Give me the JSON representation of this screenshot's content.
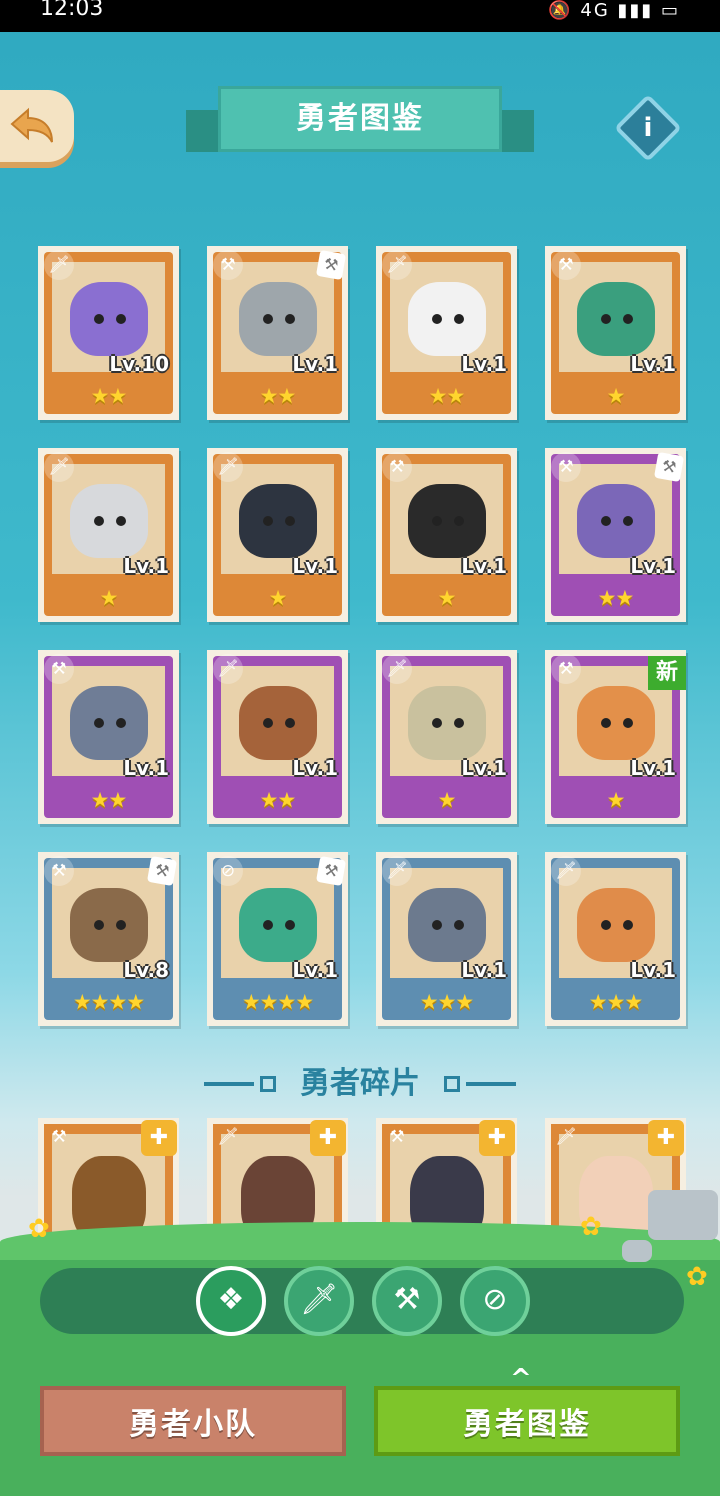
{
  "status_bar": {
    "time": "12:03",
    "icons": "🔕 4G ▮▮▮ ▭"
  },
  "header": {
    "title": "勇者图鉴",
    "info_label": "i"
  },
  "cards": [
    {
      "level": "Lv.10",
      "stars": 2,
      "frame": "orange",
      "role": "sword",
      "weapon": "",
      "new": false,
      "head_color": "#8a6fd1"
    },
    {
      "level": "Lv.1",
      "stars": 2,
      "frame": "orange",
      "role": "hammer",
      "weapon": "hammer",
      "new": false,
      "head_color": "#9ea6ab"
    },
    {
      "level": "Lv.1",
      "stars": 2,
      "frame": "orange",
      "role": "sword",
      "weapon": "",
      "new": false,
      "head_color": "#f2f2f2"
    },
    {
      "level": "Lv.1",
      "stars": 1,
      "frame": "orange",
      "role": "hammer",
      "weapon": "",
      "new": false,
      "head_color": "#3a9f7e"
    },
    {
      "level": "Lv.1",
      "stars": 1,
      "frame": "orange",
      "role": "sword",
      "weapon": "",
      "new": false,
      "head_color": "#d7d9dc"
    },
    {
      "level": "Lv.1",
      "stars": 1,
      "frame": "orange",
      "role": "sword",
      "weapon": "",
      "new": false,
      "head_color": "#2d3440"
    },
    {
      "level": "Lv.1",
      "stars": 1,
      "frame": "orange",
      "role": "hammer",
      "weapon": "",
      "new": false,
      "head_color": "#2a2a2a"
    },
    {
      "level": "Lv.1",
      "stars": 2,
      "frame": "purple",
      "role": "hammer",
      "weapon": "hammer",
      "new": false,
      "head_color": "#7b67b8"
    },
    {
      "level": "Lv.1",
      "stars": 2,
      "frame": "purple",
      "role": "hammer",
      "weapon": "",
      "new": false,
      "head_color": "#6f7d96"
    },
    {
      "level": "Lv.1",
      "stars": 2,
      "frame": "purple",
      "role": "sword",
      "weapon": "",
      "new": false,
      "head_color": "#a5633a"
    },
    {
      "level": "Lv.1",
      "stars": 1,
      "frame": "purple",
      "role": "sword",
      "weapon": "",
      "new": false,
      "head_color": "#c9c19e"
    },
    {
      "level": "Lv.1",
      "stars": 1,
      "frame": "purple",
      "role": "hammer",
      "weapon": "",
      "new": true,
      "new_label": "新",
      "head_color": "#e3904a"
    },
    {
      "level": "Lv.8",
      "stars": 4,
      "frame": "blue",
      "role": "hammer",
      "weapon": "hammer",
      "new": false,
      "head_color": "#8a6a4a"
    },
    {
      "level": "Lv.1",
      "stars": 4,
      "frame": "blue",
      "role": "compass",
      "weapon": "hammer",
      "new": false,
      "head_color": "#3cab8a"
    },
    {
      "level": "Lv.1",
      "stars": 3,
      "frame": "blue",
      "role": "sword",
      "weapon": "",
      "new": false,
      "head_color": "#6c7a8e"
    },
    {
      "level": "Lv.1",
      "stars": 3,
      "frame": "blue",
      "role": "sword",
      "weapon": "",
      "new": false,
      "head_color": "#e08c4a"
    }
  ],
  "fragments_section": {
    "title": "勇者碎片"
  },
  "fragments": [
    {
      "role": "hammer",
      "head_color": "#8a5a2a"
    },
    {
      "role": "sword",
      "head_color": "#6a4436"
    },
    {
      "role": "hammer",
      "head_color": "#3a3a4a"
    },
    {
      "role": "sword",
      "head_color": "#f2d0b8"
    }
  ],
  "filters": [
    {
      "name": "all",
      "icon": "❖",
      "active": true
    },
    {
      "name": "sword",
      "icon": "🗡",
      "active": false
    },
    {
      "name": "hammer",
      "icon": "⚒",
      "active": false
    },
    {
      "name": "compass",
      "icon": "⊘",
      "active": false
    }
  ],
  "bottom_nav": {
    "team_label": "勇者小队",
    "codex_label": "勇者图鉴",
    "chevron": "^"
  },
  "icon_glyphs": {
    "sword": "🗡",
    "hammer": "⚒",
    "compass": "⊘",
    "star": "★",
    "puzzle": "✚"
  }
}
